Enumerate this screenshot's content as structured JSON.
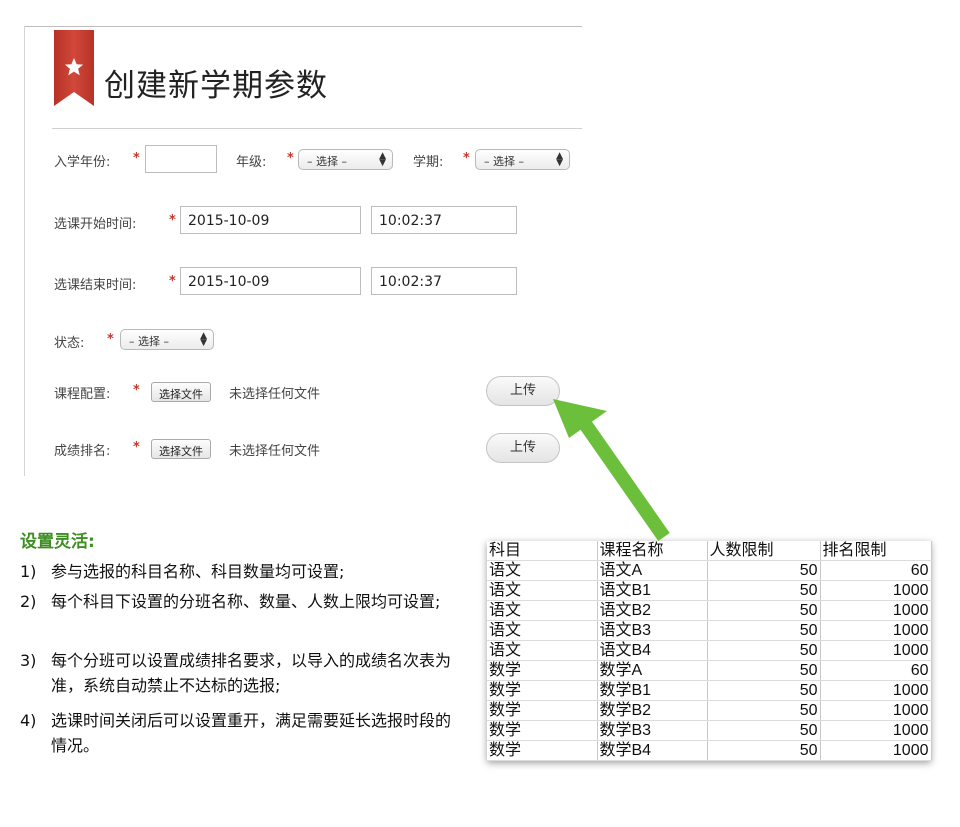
{
  "form": {
    "title": "创建新学期参数",
    "enroll_year_label": "入学年份:",
    "required_mark": "*",
    "grade_label": "年级:",
    "grade_select": "– 选择 –",
    "term_label": "学期:",
    "term_select": "– 选择 –",
    "start_label": "选课开始时间:",
    "start_date": "2015-10-09",
    "start_time": "10:02:37",
    "end_label": "选课结束时间:",
    "end_date": "2015-10-09",
    "end_time": "10:02:37",
    "status_label": "状态:",
    "status_select": "– 选择 –",
    "course_config_label": "课程配置:",
    "ranking_label": "成绩排名:",
    "choose_file_label": "选择文件",
    "no_file_text": "未选择任何文件",
    "upload_label": "上传"
  },
  "notes": {
    "heading": "设置灵活:",
    "items": [
      {
        "num": "1)",
        "text": "参与选报的科目名称、科目数量均可设置;"
      },
      {
        "num": "2)",
        "text": "每个科目下设置的分班名称、数量、人数上限均可设置;"
      },
      {
        "num": "3)",
        "text": "每个分班可以设置成绩排名要求，以导入的成绩名次表为准，系统自动禁止不达标的选报;"
      },
      {
        "num": "4)",
        "text": "选课时间关闭后可以设置重开，满足需要延长选报时段的情况。"
      }
    ]
  },
  "table": {
    "headers": [
      "科目",
      "课程名称",
      "人数限制",
      "排名限制"
    ],
    "rows": [
      [
        "语文",
        "语文A",
        "50",
        "60"
      ],
      [
        "语文",
        "语文B1",
        "50",
        "1000"
      ],
      [
        "语文",
        "语文B2",
        "50",
        "1000"
      ],
      [
        "语文",
        "语文B3",
        "50",
        "1000"
      ],
      [
        "语文",
        "语文B4",
        "50",
        "1000"
      ],
      [
        "数学",
        "数学A",
        "50",
        "60"
      ],
      [
        "数学",
        "数学B1",
        "50",
        "1000"
      ],
      [
        "数学",
        "数学B2",
        "50",
        "1000"
      ],
      [
        "数学",
        "数学B3",
        "50",
        "1000"
      ],
      [
        "数学",
        "数学B4",
        "50",
        "1000"
      ]
    ]
  },
  "colors": {
    "bookmark": "#c0392b",
    "required": "#c0392b",
    "heading_green": "#3e8e23",
    "arrow_green": "#6cbf3a"
  },
  "icons": {
    "bookmark": "star-bookmark-icon",
    "select_arrow": "up-down-arrows-icon",
    "callout": "green-arrow-icon"
  }
}
